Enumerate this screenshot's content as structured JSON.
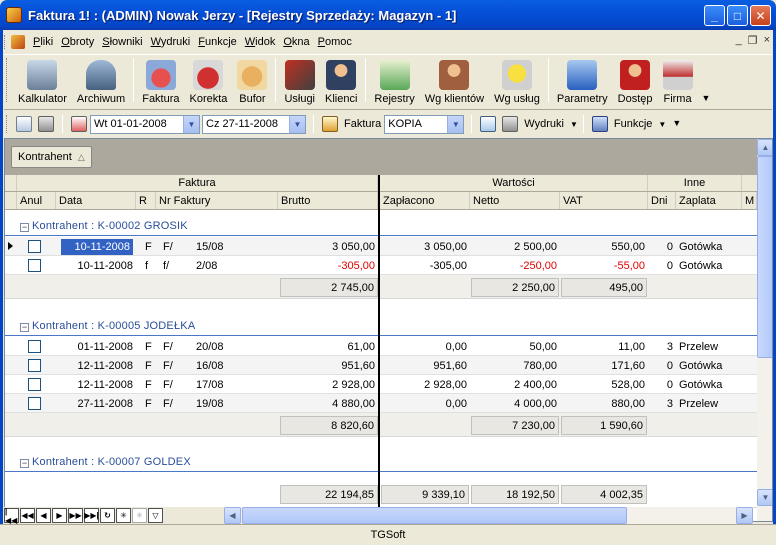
{
  "window": {
    "title": "Faktura 1!    : (ADMIN) Nowak Jerzy - [Rejestry Sprzedaży: Magazyn - 1]",
    "minimize": "_",
    "maximize": "□",
    "close": "✕"
  },
  "menu": {
    "items": [
      "Pliki",
      "Obroty",
      "Słowniki",
      "Wydruki",
      "Funkcje",
      "Widok",
      "Okna",
      "Pomoc"
    ],
    "mdi_min": "_",
    "mdi_restore": "❐",
    "mdi_close": "×"
  },
  "toolbar": {
    "buttons": [
      {
        "label": "Kalkulator",
        "icon": "calculator-icon"
      },
      {
        "label": "Archiwum",
        "icon": "archive-icon"
      },
      {
        "label": "Faktura",
        "icon": "invoice-icon"
      },
      {
        "label": "Korekta",
        "icon": "correction-icon"
      },
      {
        "label": "Bufor",
        "icon": "buffer-icon"
      },
      {
        "label": "Usługi",
        "icon": "services-icon"
      },
      {
        "label": "Klienci",
        "icon": "clients-icon"
      },
      {
        "label": "Rejestry",
        "icon": "registers-icon"
      },
      {
        "label": "Wg klientów",
        "icon": "by-clients-icon"
      },
      {
        "label": "Wg usług",
        "icon": "by-services-icon"
      },
      {
        "label": "Parametry",
        "icon": "parameters-icon"
      },
      {
        "label": "Dostęp",
        "icon": "access-icon"
      },
      {
        "label": "Firma",
        "icon": "company-icon"
      }
    ]
  },
  "filters": {
    "date_from": "Wt 01-01-2008",
    "date_to": "Cz 27-11-2008",
    "doc_type_label": "Faktura",
    "doc_type_value": "KOPIA",
    "prints_label": "Wydruki",
    "functions_label": "Funkcje"
  },
  "grid": {
    "group_by_chip": "Kontrahent",
    "bands": {
      "faktura": "Faktura",
      "wartosci": "Wartości",
      "inne": "Inne"
    },
    "columns": {
      "anul": "Anul",
      "data": "Data",
      "r": "R",
      "nr": "Nr Faktury",
      "brutto": "Brutto",
      "zaplacono": "Zapłacono",
      "netto": "Netto",
      "vat": "VAT",
      "dni": "Dni",
      "zaplata": "Zaplata",
      "m": "M"
    },
    "groups": [
      {
        "title": "Kontrahent : K-00002  GROSIK",
        "rows": [
          {
            "data": "10-11-2008",
            "r": "F",
            "nr1": "F/",
            "nr2": "15/08",
            "brutto": "3 050,00",
            "zaplacono": "3 050,00",
            "netto": "2 500,00",
            "vat": "550,00",
            "dni": "0",
            "zaplata": "Gotówka",
            "neg": false
          },
          {
            "data": "10-11-2008",
            "r": "f",
            "nr1": "f/",
            "nr2": "2/08",
            "brutto": "-305,00",
            "zaplacono": "-305,00",
            "netto": "-250,00",
            "vat": "-55,00",
            "dni": "0",
            "zaplata": "Gotówka",
            "neg": true
          }
        ],
        "sum": {
          "brutto": "2 745,00",
          "netto": "2 250,00",
          "vat": "495,00"
        }
      },
      {
        "title": "Kontrahent : K-00005  JODEŁKA",
        "rows": [
          {
            "data": "01-11-2008",
            "r": "F",
            "nr1": "F/",
            "nr2": "20/08",
            "brutto": "61,00",
            "zaplacono": "0,00",
            "netto": "50,00",
            "vat": "11,00",
            "dni": "3",
            "zaplata": "Przelew",
            "neg": false
          },
          {
            "data": "12-11-2008",
            "r": "F",
            "nr1": "F/",
            "nr2": "16/08",
            "brutto": "951,60",
            "zaplacono": "951,60",
            "netto": "780,00",
            "vat": "171,60",
            "dni": "0",
            "zaplata": "Gotówka",
            "neg": false
          },
          {
            "data": "12-11-2008",
            "r": "F",
            "nr1": "F/",
            "nr2": "17/08",
            "brutto": "2 928,00",
            "zaplacono": "2 928,00",
            "netto": "2 400,00",
            "vat": "528,00",
            "dni": "0",
            "zaplata": "Gotówka",
            "neg": false
          },
          {
            "data": "27-11-2008",
            "r": "F",
            "nr1": "F/",
            "nr2": "19/08",
            "brutto": "4 880,00",
            "zaplacono": "0,00",
            "netto": "4 000,00",
            "vat": "880,00",
            "dni": "3",
            "zaplata": "Przelew",
            "neg": false
          }
        ],
        "sum": {
          "brutto": "8 820,60",
          "netto": "7 230,00",
          "vat": "1 590,60"
        }
      },
      {
        "title": "Kontrahent : K-00007  GOLDEX",
        "rows": [],
        "sum": null
      }
    ],
    "grand_total": {
      "brutto": "22 194,85",
      "zaplacono": "9 339,10",
      "netto": "18 192,50",
      "vat": "4 002,35"
    }
  },
  "status": {
    "text": "TGSoft"
  }
}
